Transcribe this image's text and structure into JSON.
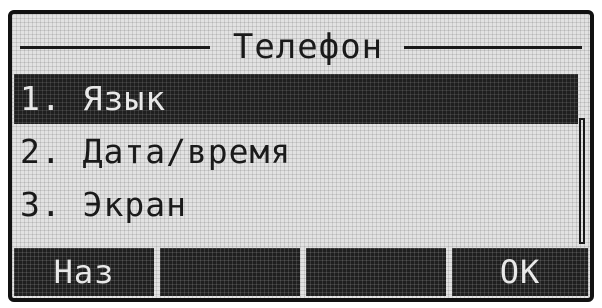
{
  "screen": {
    "title": "Телефон",
    "menu_items": [
      {
        "label": "1. Язык",
        "selected": true
      },
      {
        "label": "2. Дата/время",
        "selected": false
      },
      {
        "label": "3. Экран",
        "selected": false
      }
    ],
    "softkeys": [
      {
        "label": "Наз"
      },
      {
        "label": ""
      },
      {
        "label": ""
      },
      {
        "label": "OK"
      }
    ]
  },
  "colors": {
    "lcd_background": "#e2e2e2",
    "pixel_dark": "#1f1f1f",
    "text_dark": "#1a1a1a",
    "text_light": "#e8e8e8"
  }
}
